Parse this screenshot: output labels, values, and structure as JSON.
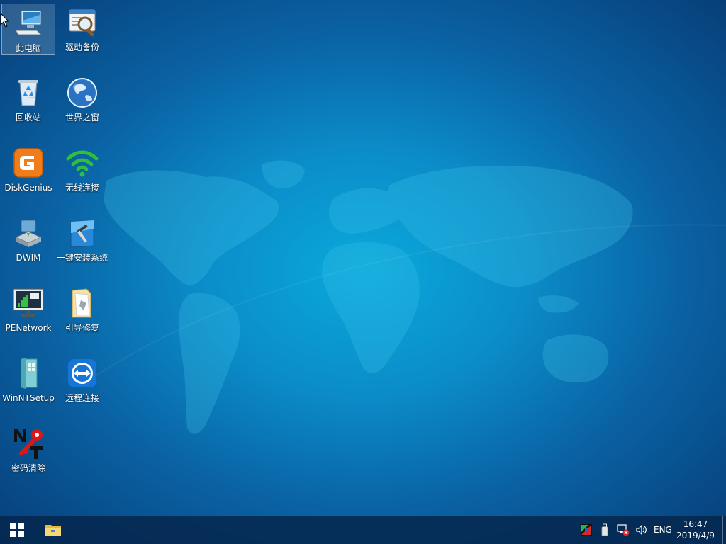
{
  "desktop": {
    "icons": [
      {
        "label": "此电脑",
        "icon": "computer-icon"
      },
      {
        "label": "驱动备份",
        "icon": "driver-backup-icon"
      },
      {
        "label": "回收站",
        "icon": "recycle-bin-icon"
      },
      {
        "label": "世界之窗",
        "icon": "globe-browser-icon"
      },
      {
        "label": "DiskGenius",
        "icon": "diskgenius-icon"
      },
      {
        "label": "无线连接",
        "icon": "wifi-icon"
      },
      {
        "label": "DWIM",
        "icon": "dwim-icon"
      },
      {
        "label": "一键安装系统",
        "icon": "system-installer-icon"
      },
      {
        "label": "PENetwork",
        "icon": "pe-network-icon"
      },
      {
        "label": "引导修复",
        "icon": "boot-repair-icon"
      },
      {
        "label": "WinNTSetup",
        "icon": "winntsetup-icon"
      },
      {
        "label": "远程连接",
        "icon": "teamviewer-icon"
      },
      {
        "label": "密码清除",
        "icon": "password-reset-icon"
      }
    ]
  },
  "taskbar": {
    "start_icon": "windows-logo-icon",
    "pinned": [
      {
        "icon": "file-explorer-icon"
      }
    ],
    "tray": {
      "icons": [
        "color-palette-icon",
        "usb-drive-icon",
        "network-disconnected-icon",
        "volume-icon"
      ],
      "language": "ENG",
      "time": "16:47",
      "date": "2019/4/9"
    }
  },
  "colors": {
    "wallpaper_center": "#0aa9dc",
    "wallpaper_edge": "#073e78",
    "taskbar": "#04284e"
  }
}
